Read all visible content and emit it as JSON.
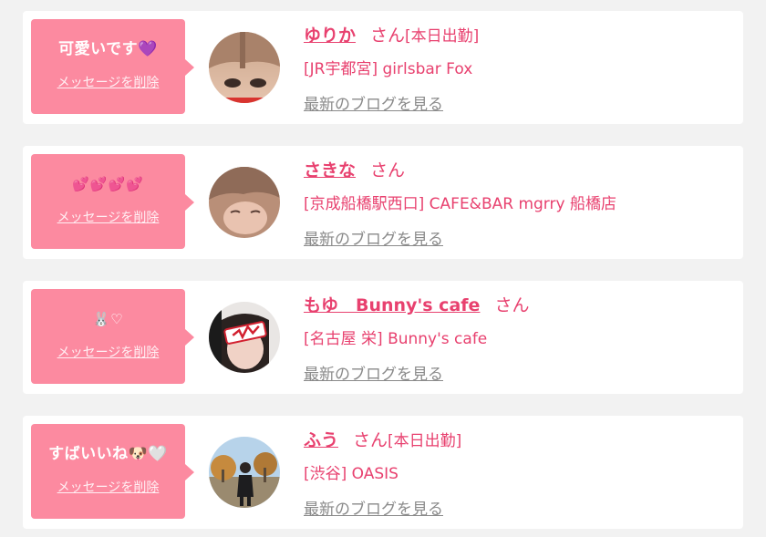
{
  "delete_label": "メッセージを削除",
  "blog_label": "最新のブログを見る",
  "san_label": "さん",
  "colors": {
    "accent": "#e8416f",
    "bubble": "#fc8aa0",
    "link_gray": "#8a8a8a",
    "background": "#f2f2f2"
  },
  "cards": [
    {
      "message": "可愛いです💜",
      "name": "ゆりか",
      "status": "[本日出勤]",
      "shop": "[JR宇都宮] girlsbar Fox"
    },
    {
      "message": "💕💕💕💕",
      "name": "さきな",
      "status": "",
      "shop": "[京成船橋駅西口] CAFE&BAR mgrry 船橋店"
    },
    {
      "message": "🐰♡",
      "name": "もゆ　Bunny's cafe",
      "status": "",
      "shop": "[名古屋 栄] Bunny's cafe"
    },
    {
      "message": "すばいいね🐶🤍",
      "name": "ふう",
      "status": "[本日出勤]",
      "shop": "[渋谷] OASIS"
    }
  ]
}
